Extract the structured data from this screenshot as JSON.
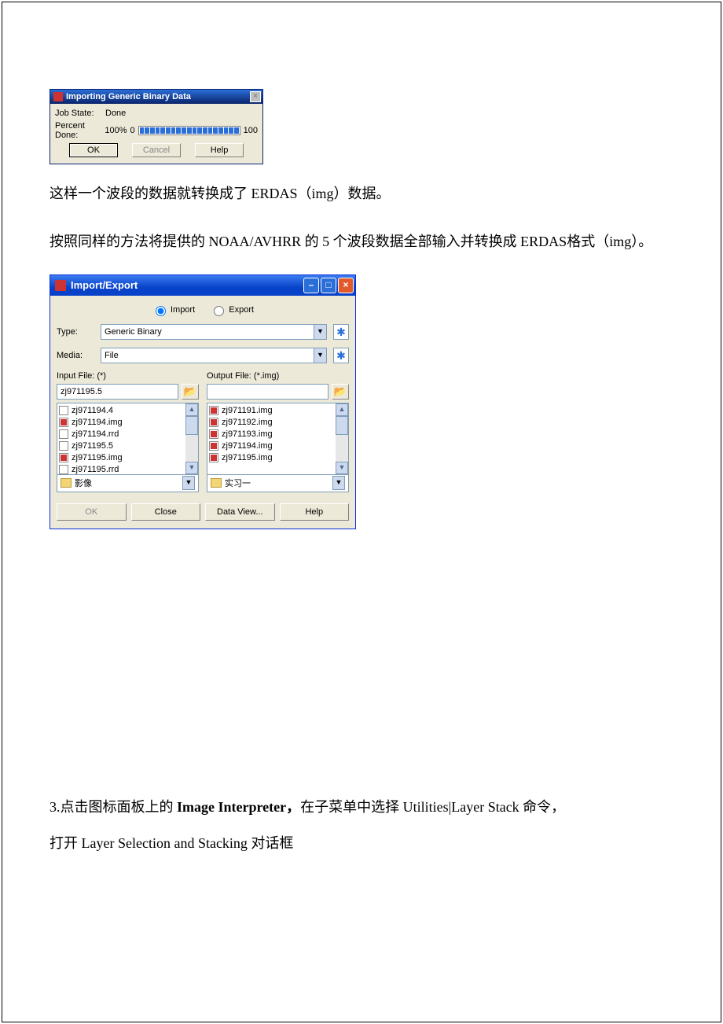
{
  "dlg1": {
    "title": "Importing Generic Binary Data",
    "job_state_label": "Job State:",
    "job_state_value": "Done",
    "percent_label": "Percent Done:",
    "percent_value": "100%",
    "scale_left": "0",
    "scale_right": "100",
    "ok": "OK",
    "cancel": "Cancel",
    "help": "Help"
  },
  "para1": "这样一个波段的数据就转换成了 ERDAS（img）数据。",
  "para2": "按照同样的方法将提供的 NOAA/AVHRR 的 5 个波段数据全部输入并转换成 ERDAS格式（img）。",
  "dlg2": {
    "title": "Import/Export",
    "import_label": "Import",
    "export_label": "Export",
    "import_checked": true,
    "type_label": "Type:",
    "type_value": "Generic Binary",
    "media_label": "Media:",
    "media_value": "File",
    "input_header": "Input File: (*)",
    "output_header": "Output File: (*.img)",
    "input_value": "zj971195.5",
    "output_value": "",
    "input_files": [
      {
        "name": "zj971194.4",
        "type": "doc"
      },
      {
        "name": "zj971194.img",
        "type": "img"
      },
      {
        "name": "zj971194.rrd",
        "type": "doc"
      },
      {
        "name": "zj971195.5",
        "type": "doc"
      },
      {
        "name": "zj971195.img",
        "type": "img"
      },
      {
        "name": "zj971195.rrd",
        "type": "doc"
      }
    ],
    "output_files": [
      {
        "name": "zj971191.img",
        "type": "img"
      },
      {
        "name": "zj971192.img",
        "type": "img"
      },
      {
        "name": "zj971193.img",
        "type": "img"
      },
      {
        "name": "zj971194.img",
        "type": "img"
      },
      {
        "name": "zj971195.img",
        "type": "img"
      }
    ],
    "input_folder": "影像",
    "output_folder": "实习一",
    "ok": "OK",
    "close": "Close",
    "data_view": "Data View...",
    "help": "Help"
  },
  "para3_prefix": "3.点击图标面板上的 ",
  "para3_bold": "Image Interpreter，",
  "para3_mid": "在子菜单中选择 Utilities|Layer Stack 命令，",
  "para3_line2": "打开 Layer Selection and Stacking 对话框"
}
